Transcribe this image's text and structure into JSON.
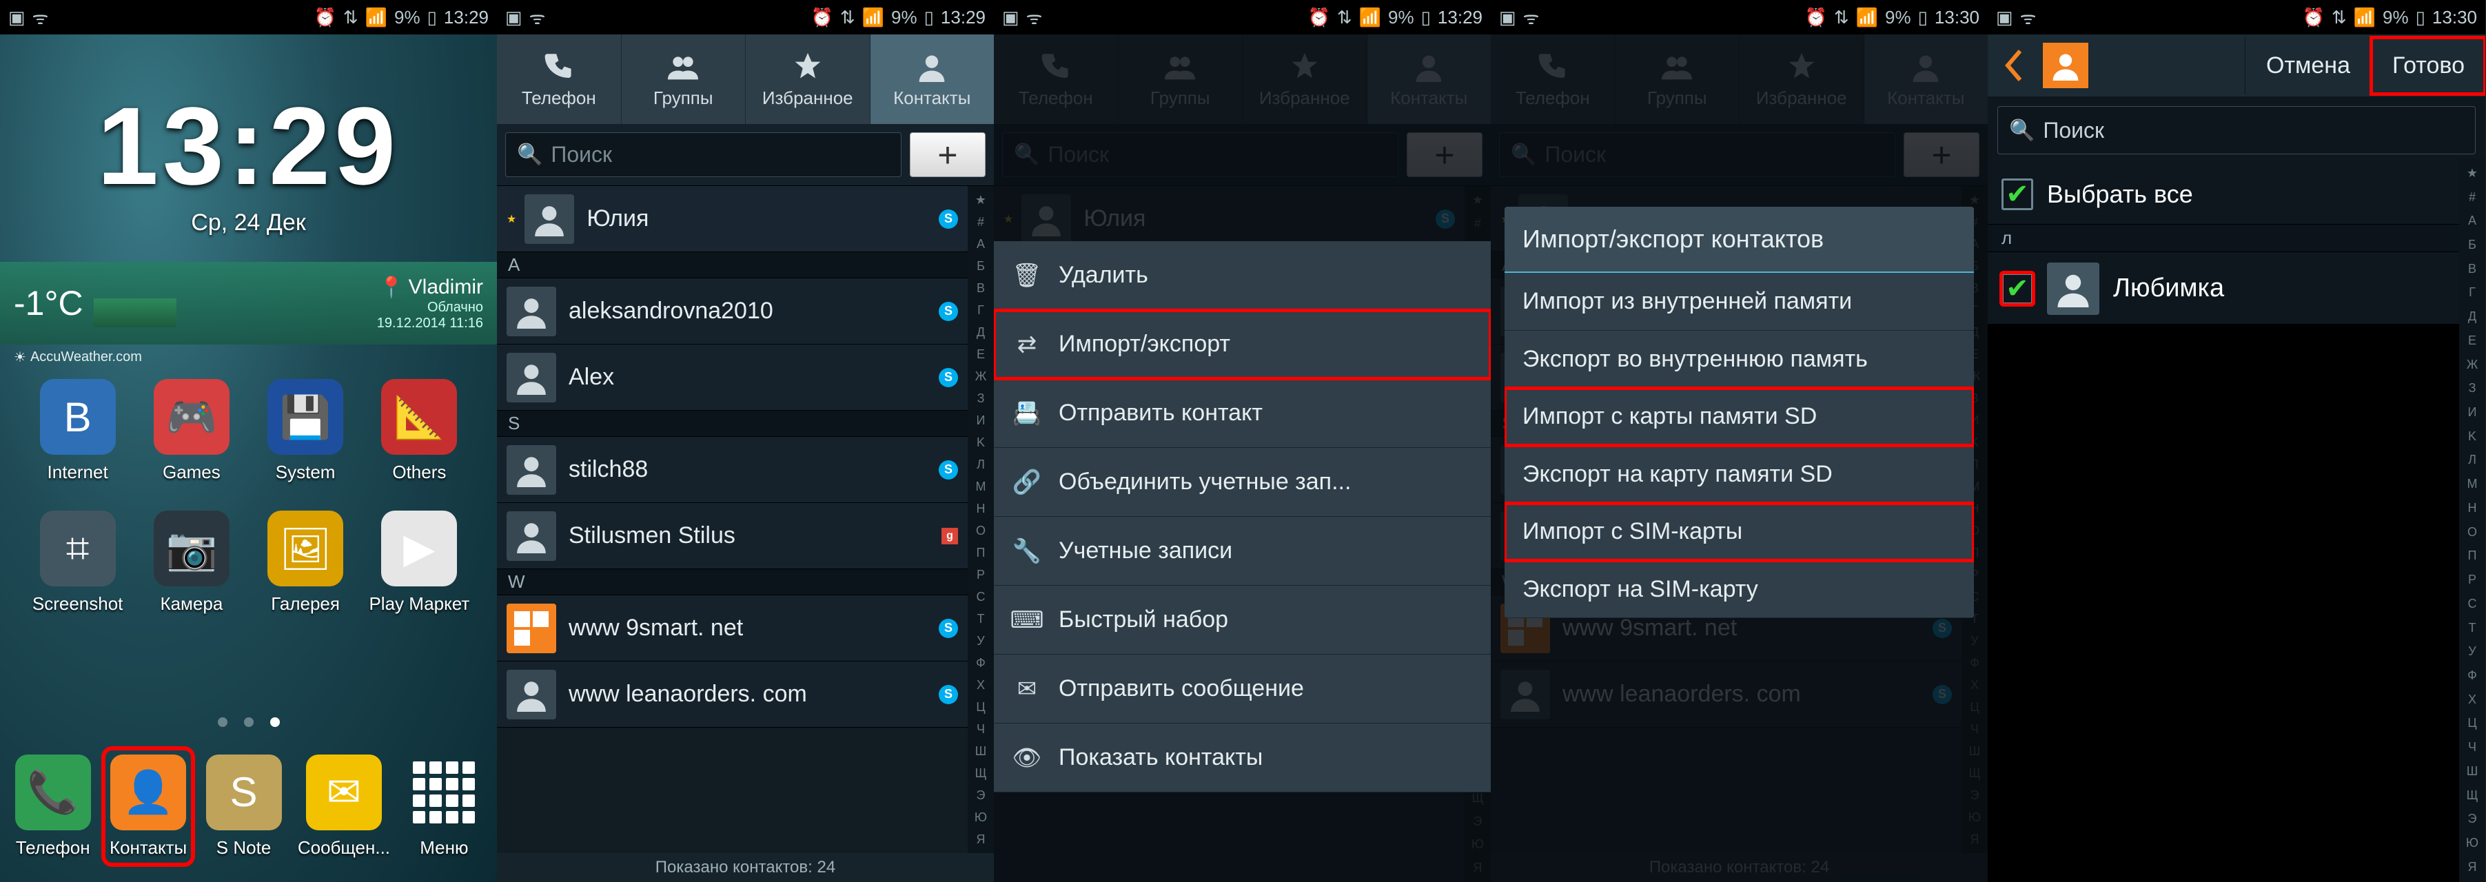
{
  "status": {
    "time1": "13:29",
    "time2": "13:29",
    "time3": "13:29",
    "time4": "13:30",
    "time5": "13:30",
    "battery_pct": "9%",
    "left_icons": [
      "gallery-icon",
      "wifi-weak-icon"
    ],
    "right_icons": [
      "alarm-icon",
      "sync-icon",
      "signal-icon"
    ]
  },
  "home": {
    "clock_time": "13:29",
    "clock_date": "Ср, 24 Дек",
    "weather_temp": "-1°C",
    "weather_city": "Vladimir",
    "weather_cond": "Облачно",
    "weather_updated": "19.12.2014 11:16",
    "accuweather": "AccuWeather.com",
    "grid": [
      {
        "label": "Internet",
        "icon": "B",
        "bg": "#2e6fb5"
      },
      {
        "label": "Games",
        "icon": "🎮",
        "bg": "#d64040"
      },
      {
        "label": "System",
        "icon": "💾",
        "bg": "#1e4f9e"
      },
      {
        "label": "Others",
        "icon": "📐",
        "bg": "#c62f2f"
      },
      {
        "label": "Screenshot",
        "icon": "⌗",
        "bg": "#425662"
      },
      {
        "label": "Камера",
        "icon": "📷",
        "bg": "#2b3740"
      },
      {
        "label": "Галерея",
        "icon": "🖼",
        "bg": "#d9a000"
      },
      {
        "label": "Play Маркет",
        "icon": "▶",
        "bg": "#e6e6e6"
      }
    ],
    "dock": [
      {
        "label": "Телефон",
        "icon": "📞",
        "bg": "#2f9e53",
        "hl": false
      },
      {
        "label": "Контакты",
        "icon": "👤",
        "bg": "#f58220",
        "hl": true
      },
      {
        "label": "S Note",
        "icon": "S",
        "bg": "#bfa35a",
        "hl": false
      },
      {
        "label": "Сообщен...",
        "icon": "✉",
        "bg": "#f2c200",
        "hl": false
      },
      {
        "label": "Меню",
        "icon": "⋮⋮⋮",
        "bg": "transparent",
        "hl": false
      }
    ]
  },
  "tabs": [
    {
      "label": "Телефон",
      "icon": "phone"
    },
    {
      "label": "Группы",
      "icon": "groups"
    },
    {
      "label": "Избранное",
      "icon": "star"
    },
    {
      "label": "Контакты",
      "icon": "contact"
    }
  ],
  "search_placeholder": "Поиск",
  "add_label": "+",
  "favorite": {
    "name": "Юлия"
  },
  "sections": [
    {
      "letter": "A",
      "contacts": [
        {
          "name": "aleksandrovna2010",
          "badge": "skype"
        },
        {
          "name": "Alex",
          "badge": "skype"
        }
      ]
    },
    {
      "letter": "S",
      "contacts": [
        {
          "name": "stilch88",
          "badge": "skype"
        },
        {
          "name": "Stilusmen Stilus",
          "badge": "google"
        }
      ]
    },
    {
      "letter": "W",
      "contacts": [
        {
          "name": "www 9smart. net",
          "badge": "skype"
        },
        {
          "name": "www leanaorders. com",
          "badge": "skype"
        }
      ]
    }
  ],
  "count_label": "Показано контактов: 24",
  "index_letters": [
    "★",
    "#",
    "A",
    "Б",
    "B",
    "Г",
    "Д",
    "E",
    "Ж",
    "З",
    "И",
    "K",
    "Л",
    "M",
    "H",
    "O",
    "П",
    "P",
    "C",
    "T",
    "У",
    "Ф",
    "X",
    "Ц",
    "Ч",
    "Ш",
    "Щ",
    "Э",
    "Ю",
    "Я"
  ],
  "ctx_menu": [
    {
      "label": "Удалить",
      "icon": "trash",
      "hl": false
    },
    {
      "label": "Импорт/экспорт",
      "icon": "swap",
      "hl": true
    },
    {
      "label": "Отправить контакт",
      "icon": "card",
      "hl": false
    },
    {
      "label": "Объединить учетные зап...",
      "icon": "merge",
      "hl": false
    },
    {
      "label": "Учетные записи",
      "icon": "wrench",
      "hl": false
    },
    {
      "label": "Быстрый набор",
      "icon": "dial",
      "hl": false
    },
    {
      "label": "Отправить сообщение",
      "icon": "msg",
      "hl": false
    },
    {
      "label": "Показать контакты",
      "icon": "eye",
      "hl": false
    }
  ],
  "dialog": {
    "title": "Импорт/экспорт контактов",
    "items": [
      {
        "label": "Импорт из внутренней памяти",
        "hl": false
      },
      {
        "label": "Экспорт во внутреннюю память",
        "hl": false
      },
      {
        "label": "Импорт с карты памяти SD",
        "hl": true
      },
      {
        "label": "Экспорт на карту памяти SD",
        "hl": false
      },
      {
        "label": "Импорт с SIM-карты",
        "hl": true
      },
      {
        "label": "Экспорт на SIM-карту",
        "hl": false
      }
    ]
  },
  "screen5": {
    "cancel": "Отмена",
    "done": "Готово",
    "select_all": "Выбрать все",
    "section": "л",
    "item": "Любимка",
    "item_checked": true
  }
}
